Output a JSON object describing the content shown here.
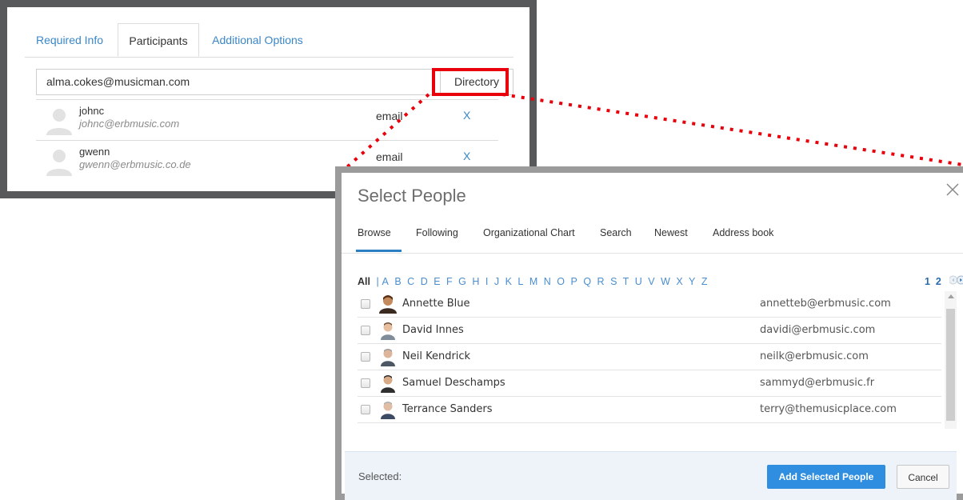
{
  "back_panel": {
    "tabs": [
      "Required Info",
      "Participants",
      "Additional Options"
    ],
    "email_input_value": "alma.cokes@musicman.com",
    "directory_label": "Directory",
    "participants": [
      {
        "name": "johnc",
        "email": "johnc@erbmusic.com",
        "type": "email",
        "remove": "X"
      },
      {
        "name": "gwenn",
        "email": "gwenn@erbmusic.co.de",
        "type": "email",
        "remove": "X"
      }
    ]
  },
  "dialog": {
    "title": "Select People",
    "close_icon": "close-icon",
    "tabs": [
      "Browse",
      "Following",
      "Organizational Chart",
      "Search",
      "Newest",
      "Address book"
    ],
    "active_tab": "Browse",
    "filter_all": "All",
    "filter_sep": "|",
    "letters": [
      "A",
      "B",
      "C",
      "D",
      "E",
      "F",
      "G",
      "H",
      "I",
      "J",
      "K",
      "L",
      "M",
      "N",
      "O",
      "P",
      "Q",
      "R",
      "S",
      "T",
      "U",
      "V",
      "W",
      "X",
      "Y",
      "Z"
    ],
    "pages": [
      "1",
      "2"
    ],
    "people": [
      {
        "name": "Annette Blue",
        "email": "annetteb@erbmusic.com"
      },
      {
        "name": "David Innes",
        "email": "davidi@erbmusic.com"
      },
      {
        "name": "Neil Kendrick",
        "email": "neilk@erbmusic.com"
      },
      {
        "name": "Samuel Deschamps",
        "email": "sammyd@erbmusic.fr"
      },
      {
        "name": "Terrance Sanders",
        "email": "terry@themusicplace.com"
      }
    ],
    "selected_label": "Selected:",
    "add_button": "Add Selected People",
    "cancel_button": "Cancel"
  },
  "colors": {
    "accent_blue": "#3a87c8",
    "highlight_red": "#e8000b",
    "primary_button": "#2f8ee0",
    "frame_gray": "#58595b"
  }
}
